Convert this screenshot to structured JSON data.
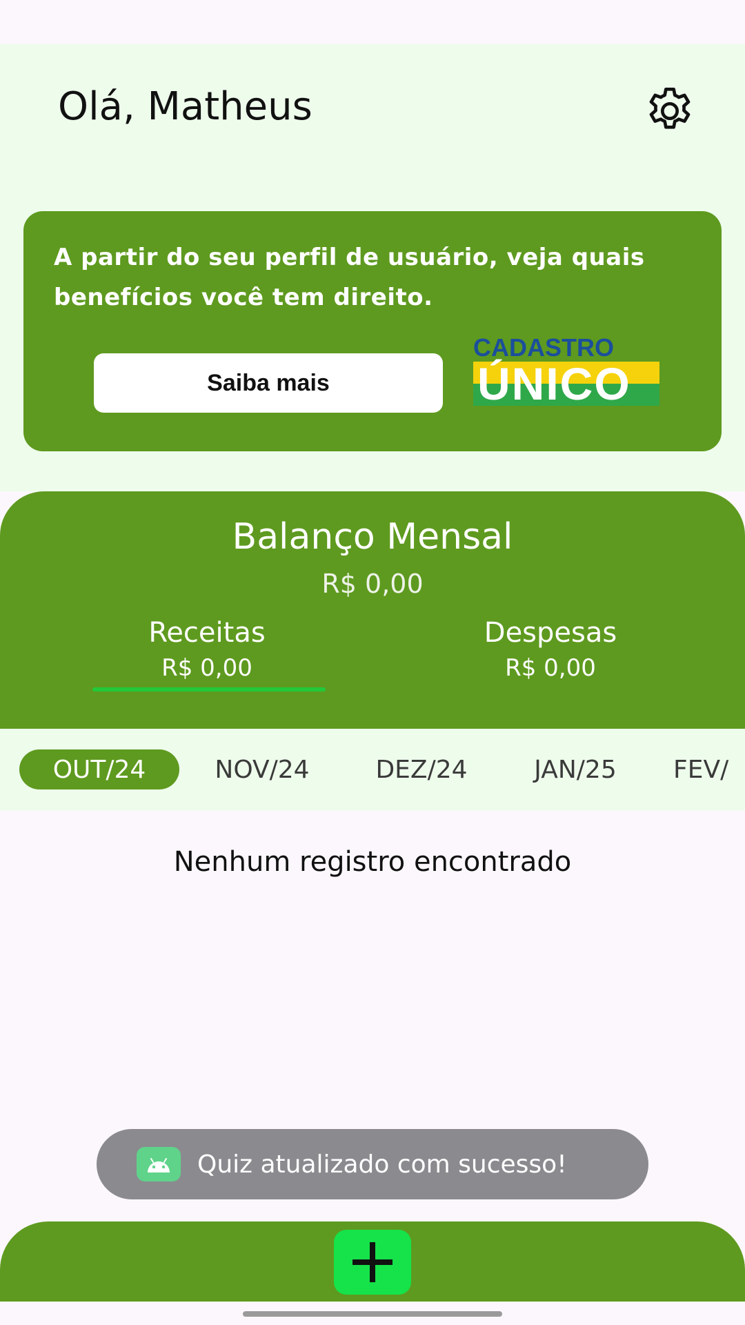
{
  "header": {
    "greeting": "Olá, Matheus",
    "settings_icon": "gear-icon"
  },
  "benefit_card": {
    "text": "A partir do seu perfil de usuário, veja quais benefícios você tem direito.",
    "button_label": "Saiba mais",
    "logo_top": "CADASTRO",
    "logo_bottom": "ÚNICO",
    "colors": {
      "card": "#5e9a1f",
      "logo_blue": "#1b4f9c",
      "logo_yellow": "#f5d20b",
      "logo_green": "#2fa84a"
    }
  },
  "balance": {
    "title": "Balanço Mensal",
    "total": "R$ 0,00",
    "receitas_label": "Receitas",
    "receitas_value": "R$ 0,00",
    "despesas_label": "Despesas",
    "despesas_value": "R$ 0,00"
  },
  "months": {
    "items": [
      "OUT/24",
      "NOV/24",
      "DEZ/24",
      "JAN/25",
      "FEV/"
    ],
    "selected": "OUT/24"
  },
  "empty_state": "Nenhum registro encontrado",
  "toast": {
    "icon": "android-icon",
    "message": "Quiz atualizado com sucesso!"
  },
  "bottom_bar": {
    "add_icon": "plus-icon",
    "colors": {
      "bar": "#5e9a1f",
      "fab": "#16e24a"
    }
  }
}
